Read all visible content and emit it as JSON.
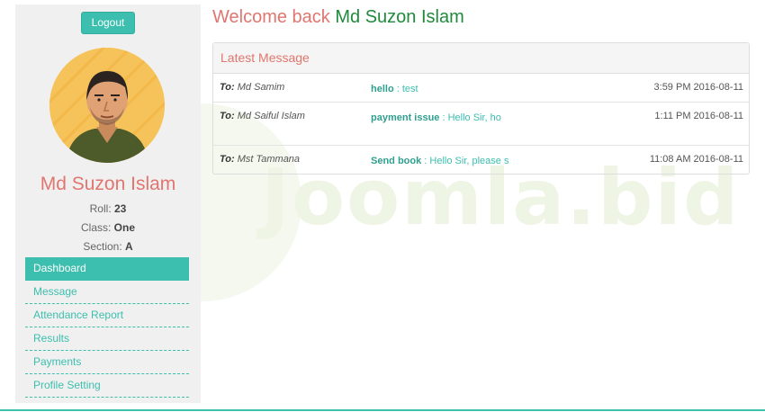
{
  "watermark": "Joomla.bid",
  "sidebar": {
    "logout_label": "Logout",
    "profile_name": "Md Suzon Islam",
    "roll_label": "Roll:",
    "roll_value": "23",
    "class_label": "Class:",
    "class_value": "One",
    "section_label": "Section:",
    "section_value": "A",
    "menu": [
      {
        "label": "Dashboard",
        "active": true
      },
      {
        "label": "Message"
      },
      {
        "label": "Attendance Report"
      },
      {
        "label": "Results"
      },
      {
        "label": "Payments"
      },
      {
        "label": "Profile Setting"
      }
    ]
  },
  "header": {
    "welcome_prefix": "Welcome back",
    "user_name": "Md Suzon Islam"
  },
  "messages": {
    "title": "Latest Message",
    "to_label": "To:",
    "rows": [
      {
        "to": "Md Samim",
        "subject": "hello",
        "sep": " : ",
        "preview": "test",
        "time": "3:59 PM 2016-08-11"
      },
      {
        "to": "Md Saiful Islam",
        "subject": "payment issue",
        "sep": " : ",
        "preview": "Hello Sir, ho",
        "time": "1:11 PM 2016-08-11"
      },
      {
        "to": "Mst Tammana",
        "subject": "Send book",
        "sep": " : ",
        "preview": "Hello Sir, please s",
        "time": "11:08 AM 2016-08-11"
      }
    ]
  },
  "colors": {
    "accent": "#3cbfae",
    "name_pink": "#e0766f",
    "name_green": "#1f8a3c",
    "sidebar_bg": "#f0f0f0"
  }
}
